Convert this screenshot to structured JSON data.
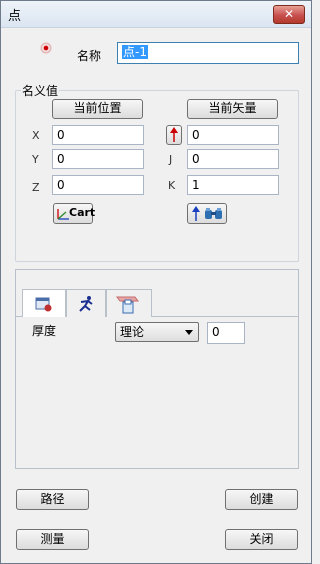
{
  "window": {
    "title": "点",
    "close_label": "✕"
  },
  "name_field": {
    "label": "名称",
    "value": "点-1"
  },
  "nominal": {
    "group_label": "名义值",
    "current_position_button": "当前位置",
    "current_vector_button": "当前矢量",
    "x_label": "X",
    "x_value": "0",
    "y_label": "Y",
    "y_value": "0",
    "z_label": "Z",
    "z_value": "0",
    "i_label": "I",
    "i_value": "0",
    "j_label": "J",
    "j_value": "0",
    "k_label": "K",
    "k_value": "1",
    "cart_button": "Cart"
  },
  "tabs": [
    {
      "icon": "settings-icon",
      "active": true
    },
    {
      "icon": "runner-icon",
      "active": false
    },
    {
      "icon": "document-icon",
      "active": false
    }
  ],
  "thickness": {
    "label": "厚度",
    "mode_selected": "理论",
    "value": "0"
  },
  "buttons": {
    "path": "路径",
    "create": "创建",
    "measure": "测量",
    "close": "关闭"
  },
  "colors": {
    "accent_red": "#cc0000",
    "accent_blue": "#1a3fbf"
  }
}
